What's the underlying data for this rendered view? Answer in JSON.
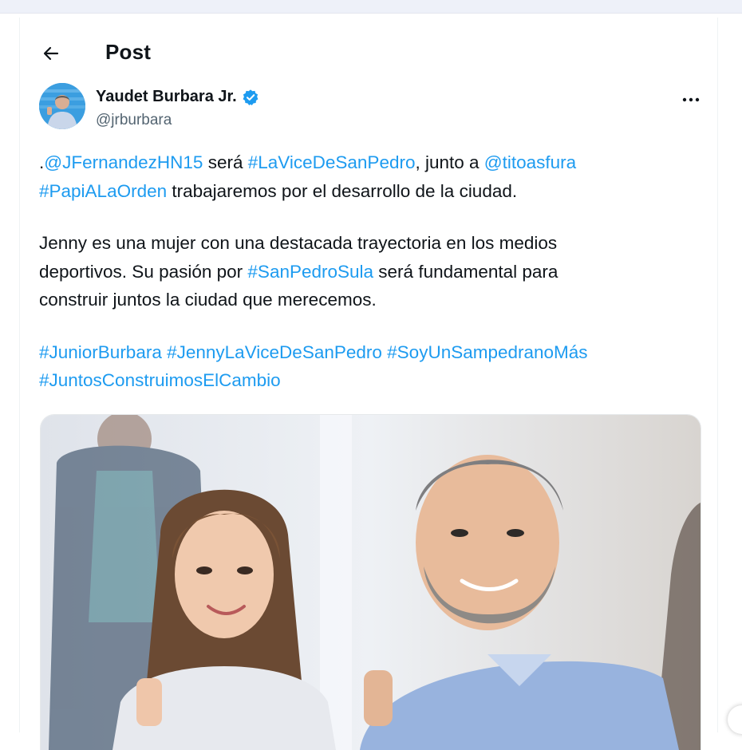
{
  "header": {
    "title": "Post"
  },
  "author": {
    "display_name": "Yaudet Burbara Jr.",
    "handle": "@jrburbara",
    "verified": true
  },
  "post": {
    "line1": {
      "pre": ".",
      "mention1": "@JFernandezHN15",
      "t1": " será ",
      "hashtag1": "#LaViceDeSanPedro",
      "t2": ", junto a ",
      "mention2": "@titoasfura"
    },
    "line2": {
      "hashtag": "#PapiALaOrden",
      "text": " trabajaremos por el desarrollo de la ciudad."
    },
    "para2": {
      "line1": "Jenny es una mujer con una destacada trayectoria en los medios",
      "line2_pre": "deportivos. Su pasión por ",
      "line2_hashtag": "#SanPedroSula",
      "line2_post": " será fundamental para",
      "line3": "construir juntos la ciudad que merecemos."
    },
    "hashtags": {
      "h1": "#JuniorBurbara",
      "h2": "#JennyLaViceDeSanPedro",
      "h3": "#SoyUnSampedranoMás",
      "h4": "#JuntosConstruimosElCambio"
    }
  },
  "icons": {
    "back": "arrow-left-icon",
    "verified": "verified-badge-icon",
    "more": "more-horizontal-icon"
  },
  "colors": {
    "link": "#1d9bf0",
    "text": "#0f1419",
    "secondary": "#536471",
    "verified": "#1d9bf0"
  }
}
